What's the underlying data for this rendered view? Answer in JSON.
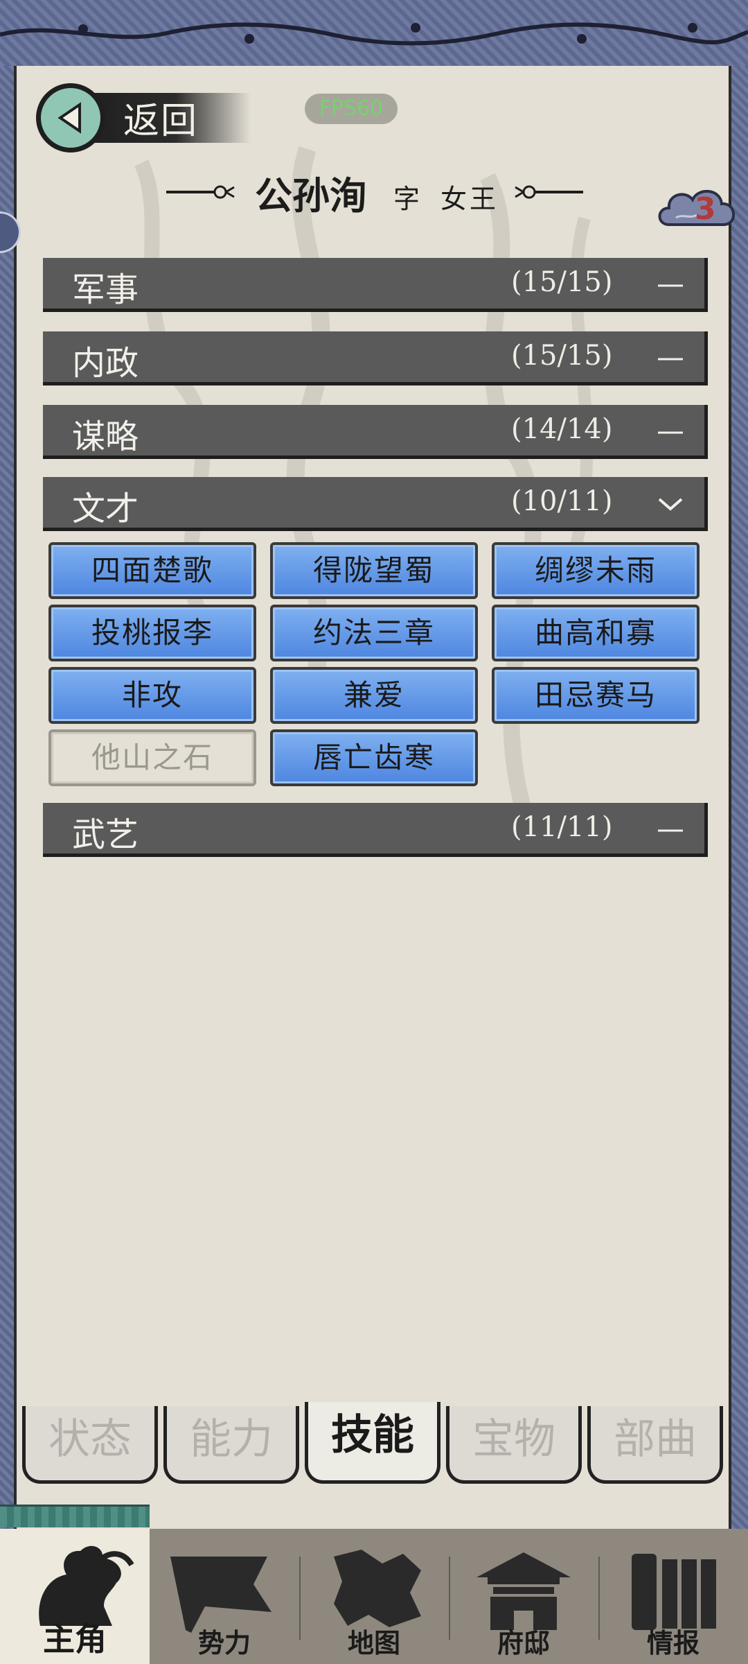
{
  "header": {
    "back_label": "返回",
    "fps": "FPS60",
    "name": "公孙洵",
    "zi_label": "字",
    "style_name": "女王",
    "notification_count": "3"
  },
  "categories": [
    {
      "label": "军事",
      "count": "(15/15)",
      "state": "collapsed"
    },
    {
      "label": "内政",
      "count": "(15/15)",
      "state": "collapsed"
    },
    {
      "label": "谋略",
      "count": "(14/14)",
      "state": "collapsed"
    },
    {
      "label": "文才",
      "count": "(10/11)",
      "state": "expanded"
    },
    {
      "label": "武艺",
      "count": "(11/11)",
      "state": "collapsed"
    }
  ],
  "skills": [
    {
      "label": "四面楚歌",
      "learned": true
    },
    {
      "label": "得陇望蜀",
      "learned": true
    },
    {
      "label": "绸缪未雨",
      "learned": true
    },
    {
      "label": "投桃报李",
      "learned": true
    },
    {
      "label": "约法三章",
      "learned": true
    },
    {
      "label": "曲高和寡",
      "learned": true
    },
    {
      "label": "非攻",
      "learned": true
    },
    {
      "label": "兼爱",
      "learned": true
    },
    {
      "label": "田忌赛马",
      "learned": true
    },
    {
      "label": "他山之石",
      "learned": false
    },
    {
      "label": "唇亡齿寒",
      "learned": true
    }
  ],
  "tabs": [
    {
      "label": "状态",
      "active": false
    },
    {
      "label": "能力",
      "active": false
    },
    {
      "label": "技能",
      "active": true
    },
    {
      "label": "宝物",
      "active": false
    },
    {
      "label": "部曲",
      "active": false
    }
  ],
  "nav": [
    {
      "label": "主角",
      "icon": "warrior-icon",
      "active": true
    },
    {
      "label": "势力",
      "icon": "flag-icon",
      "active": false
    },
    {
      "label": "地图",
      "icon": "map-icon",
      "active": false
    },
    {
      "label": "府邸",
      "icon": "mansion-icon",
      "active": false
    },
    {
      "label": "情报",
      "icon": "scroll-icon",
      "active": false
    }
  ],
  "colors": {
    "paper": "#e4e0d5",
    "category_bar": "#5a5a5a",
    "skill_blue": "#4e86e0",
    "frame_blue": "#6f7aa0",
    "notification_red": "#b23a3a"
  }
}
